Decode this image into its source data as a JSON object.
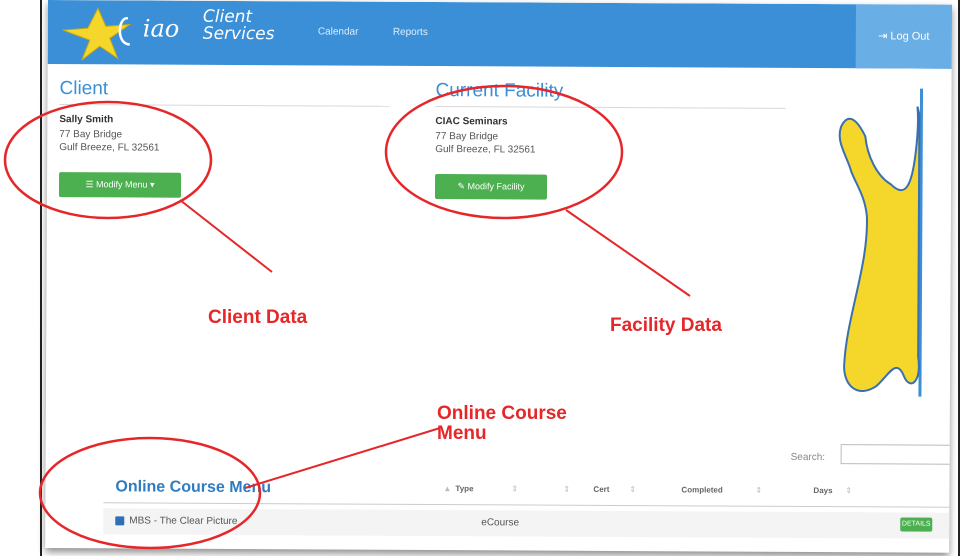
{
  "header": {
    "logo_text": "iao",
    "brand_line1": "Client",
    "brand_line2": "Services",
    "nav": [
      "Calendar",
      "Reports"
    ],
    "logout_label": "Log Out"
  },
  "client": {
    "title": "Client",
    "name": "Sally Smith",
    "address_line1": "77 Bay Bridge",
    "address_line2": "Gulf Breeze, FL 32561",
    "button_label": "Modify Menu"
  },
  "facility": {
    "title": "Current Facility",
    "name": "CIAC Seminars",
    "address_line1": "77 Bay Bridge",
    "address_line2": "Gulf Breeze, FL 32561",
    "button_label": "Modify Facility"
  },
  "annotations": {
    "client": "Client Data",
    "facility": "Facility Data",
    "course_line1": "Online Course",
    "course_line2": "Menu"
  },
  "table": {
    "search_label": "Search:",
    "search_value": "",
    "title": "Online Course Menu",
    "columns": [
      "Type",
      "Cert",
      "Completed",
      "Days"
    ],
    "rows": [
      {
        "course": "MBS - The Clear Picture",
        "type": "eCourse",
        "action": "DETAILS"
      }
    ]
  },
  "colors": {
    "navbar": "#3a8fd6",
    "accent_green": "#4caf50",
    "annotation_red": "#e5272a",
    "mascot_yellow": "#f4d72a"
  }
}
